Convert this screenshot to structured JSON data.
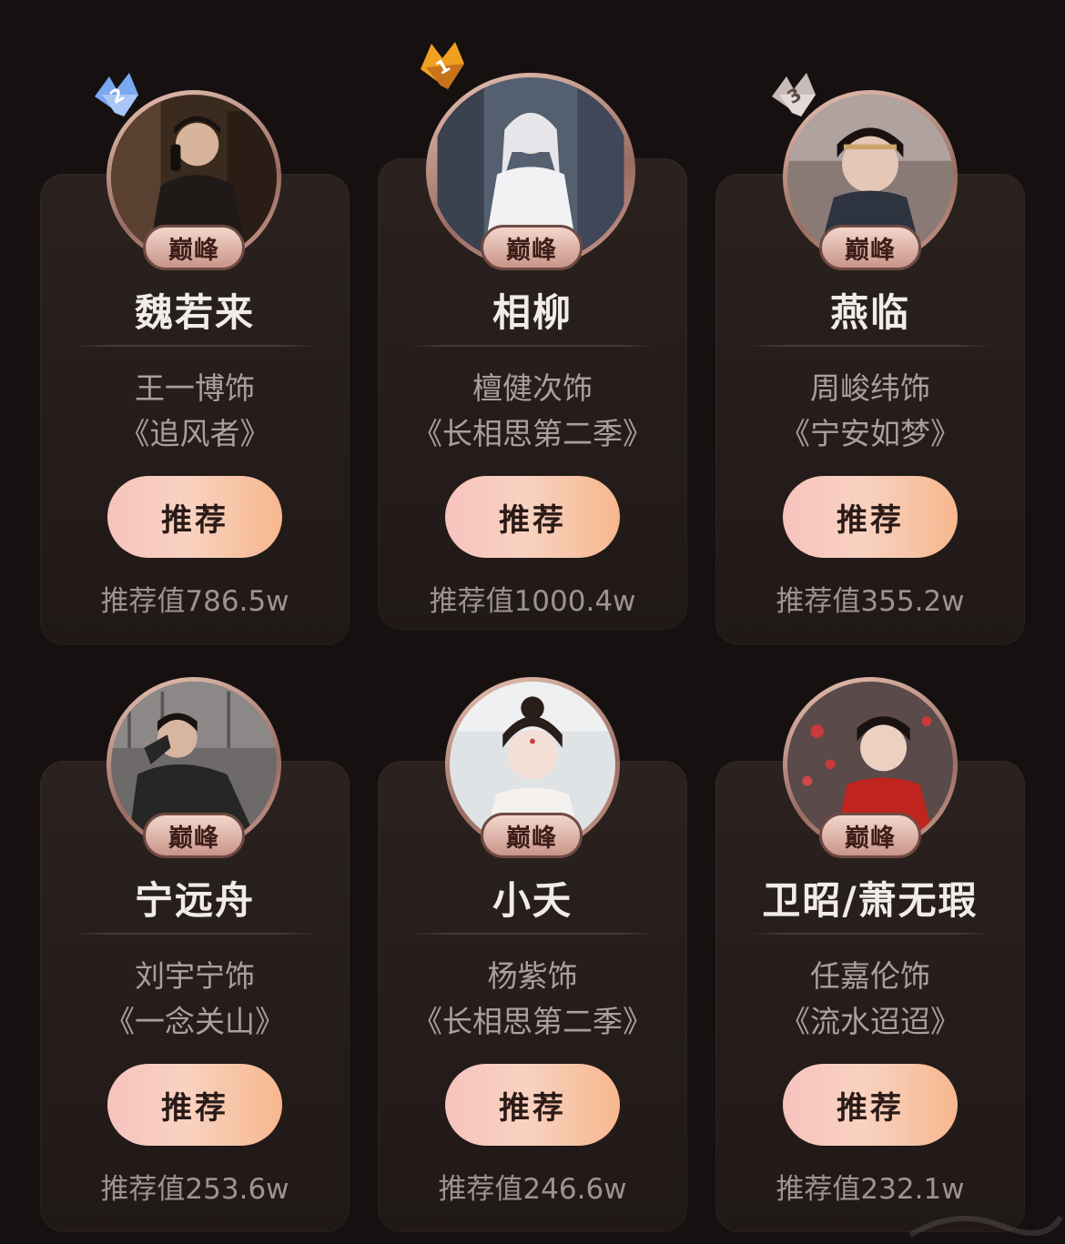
{
  "cards": [
    {
      "rank": "2",
      "badge": "巅峰",
      "name": "魏若来",
      "actor": "王一博饰",
      "drama": "《追风者》",
      "button": "推荐",
      "score": "推荐值786.5w"
    },
    {
      "rank": "1",
      "badge": "巅峰",
      "name": "相柳",
      "actor": "檀健次饰",
      "drama": "《长相思第二季》",
      "button": "推荐",
      "score": "推荐值1000.4w"
    },
    {
      "rank": "3",
      "badge": "巅峰",
      "name": "燕临",
      "actor": "周峻纬饰",
      "drama": "《宁安如梦》",
      "button": "推荐",
      "score": "推荐值355.2w"
    },
    {
      "badge": "巅峰",
      "name": "宁远舟",
      "actor": "刘宇宁饰",
      "drama": "《一念关山》",
      "button": "推荐",
      "score": "推荐值253.6w"
    },
    {
      "badge": "巅峰",
      "name": "小夭",
      "actor": "杨紫饰",
      "drama": "《长相思第二季》",
      "button": "推荐",
      "score": "推荐值246.6w"
    },
    {
      "badge": "巅峰",
      "name": "卫昭/萧无瑕",
      "actor": "任嘉伦饰",
      "drama": "《流水迢迢》",
      "button": "推荐",
      "score": "推荐值232.1w"
    }
  ],
  "colors": {
    "background": "#161110",
    "card": "#2b2220",
    "button_left": "#f7c3bd",
    "button_right": "#f7b78e",
    "rank_1": "#f0a020",
    "rank_2": "#7aa8f0",
    "rank_3": "#c9bcb8"
  },
  "icons": {
    "rank_badge": "crown-rank-icon",
    "avatar": "portrait-avatar"
  }
}
